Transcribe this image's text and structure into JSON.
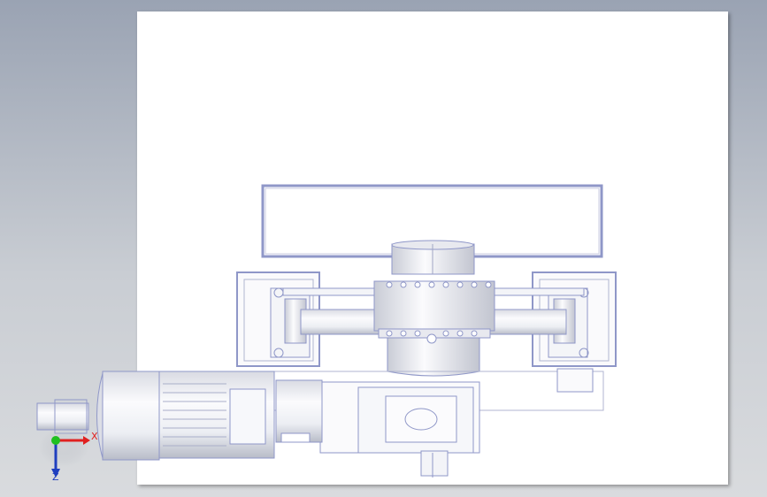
{
  "viewport": {
    "background_top": "#9aa3b3",
    "background_bottom": "#d9dbde",
    "sheet_color": "#ffffff",
    "line_color": "#8f97c8",
    "metal_light": "#f2f3f7",
    "metal_dark": "#b9bdca"
  },
  "triad": {
    "x_label": "X",
    "z_label": "Z",
    "x_color": "#e02020",
    "y_color": "#20c020",
    "z_color": "#1f3fbf"
  },
  "icons": [
    "coordinate-triad-icon"
  ]
}
